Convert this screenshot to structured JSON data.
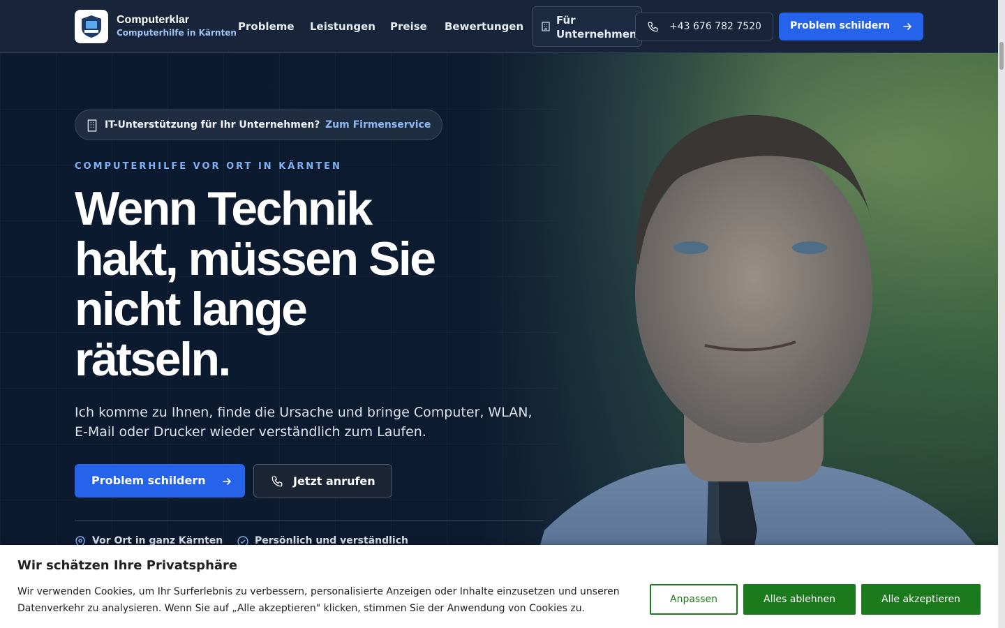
{
  "brand": {
    "name": "Computerklar",
    "tagline": "Computerhilfe in Kärnten"
  },
  "nav": {
    "items": [
      "Probleme",
      "Leistungen",
      "Preise",
      "Bewertungen"
    ],
    "for_business_line1": "Für",
    "for_business_line2": "Unternehmen",
    "phone": "+43 676 782 7520",
    "cta": "Problem schildern"
  },
  "hero": {
    "pill_text": "IT-Unterstützung für Ihr Unternehmen?",
    "pill_link": "Zum Firmenservice",
    "eyebrow": "COMPUTERHILFE VOR ORT IN KÄRNTEN",
    "headline_lines": [
      "Wenn Technik",
      "hakt, müssen Sie",
      "nicht lange",
      "rätseln."
    ],
    "lede": "Ich komme zu Ihnen, finde die Ursache und bringe Computer, WLAN, E-Mail oder Drucker wieder verständlich zum Laufen.",
    "primary_cta": "Problem schildern",
    "secondary_cta": "Jetzt anrufen",
    "features": [
      "Vor Ort in ganz Kärnten",
      "Persönlich und verständlich"
    ]
  },
  "cookie": {
    "title": "Wir schätzen Ihre Privatsphäre",
    "text": "Wir verwenden Cookies, um Ihr Surferlebnis zu verbessern, personalisierte Anzeigen oder Inhalte einzusetzen und unseren Datenverkehr zu analysieren. Wenn Sie auf „Alle akzeptieren\" klicken, stimmen Sie der Anwendung von Cookies zu.",
    "customize": "Anpassen",
    "reject": "Alles ablehnen",
    "accept": "Alle akzeptieren"
  },
  "colors": {
    "primary": "#2563eb",
    "accent_text": "#8db9f5",
    "cookie_green": "#1b7a1b",
    "header_bg": "#17243a"
  }
}
